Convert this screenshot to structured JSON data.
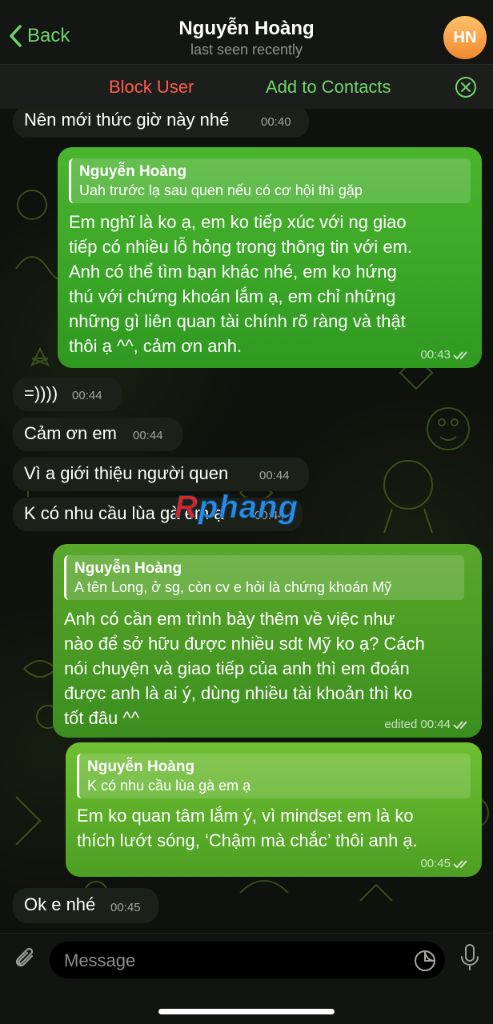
{
  "header": {
    "back_label": "Back",
    "title": "Nguyễn Hoàng",
    "subtitle": "last seen recently",
    "avatar_initials": "HN"
  },
  "actionbar": {
    "block_label": "Block User",
    "add_label": "Add to Contacts"
  },
  "messages": [
    {
      "side": "in",
      "text": "Nên mới thức giờ này nhé",
      "time": "00:40"
    },
    {
      "side": "out",
      "reply_name": "Nguyễn Hoàng",
      "reply_text": "Uah trước lạ sau quen nếu có cơ hội thì gặp",
      "lines": [
        "Em nghĩ là ko ạ, em ko tiếp xúc với ng giao",
        "tiếp có nhiều lỗ hỏng trong thông tin với em.",
        "Anh có thể tìm bạn khác nhé, em ko hứng",
        "thú với chứng khoán lắm ạ, em chỉ những",
        "những gì liên quan tài chính rõ ràng và thật",
        "thôi ạ ^^, cảm ơn anh."
      ],
      "time": "00:43"
    },
    {
      "side": "in",
      "text": "=))))",
      "time": "00:44"
    },
    {
      "side": "in",
      "text": "Cảm ơn em",
      "time": "00:44"
    },
    {
      "side": "in",
      "text": "Vì a giới thiệu người quen",
      "time": "00:44"
    },
    {
      "side": "in",
      "text": "K có nhu cầu lùa gà em ạ",
      "time": "00:44"
    },
    {
      "side": "out",
      "reply_name": "Nguyễn Hoàng",
      "reply_text": "A tên Long, ở sg, còn cv e hỏi là chứng khoán Mỹ",
      "lines": [
        "Anh có cần em trình bày thêm về việc như",
        "nào để sở hữu được nhiều sdt Mỹ ko ạ? Cách",
        "nói chuyện và giao tiếp của anh thì em đoán",
        "được anh là ai ý, dùng nhiều tài khoản thì ko",
        "tốt đâu ^^"
      ],
      "time": "edited 00:44"
    },
    {
      "side": "out",
      "reply_name": "Nguyễn Hoàng",
      "reply_text": "K có nhu cầu lùa gà em ạ",
      "lines": [
        "Em ko quan tâm lắm ý, vì mindset em là ko",
        "thích lướt sóng, ‘Chậm mà chắc’ thôi anh ạ."
      ],
      "time": "00:45"
    },
    {
      "side": "in",
      "text": "Ok e nhé",
      "time": "00:45"
    }
  ],
  "watermark": {
    "first": "R",
    "rest": "phang"
  },
  "input": {
    "placeholder": "Message"
  },
  "colors": {
    "accent_green": "#6fd66a",
    "danger_red": "#ff5a4d",
    "out_bubble": "#3fa828",
    "in_bubble": "#1b2019"
  }
}
